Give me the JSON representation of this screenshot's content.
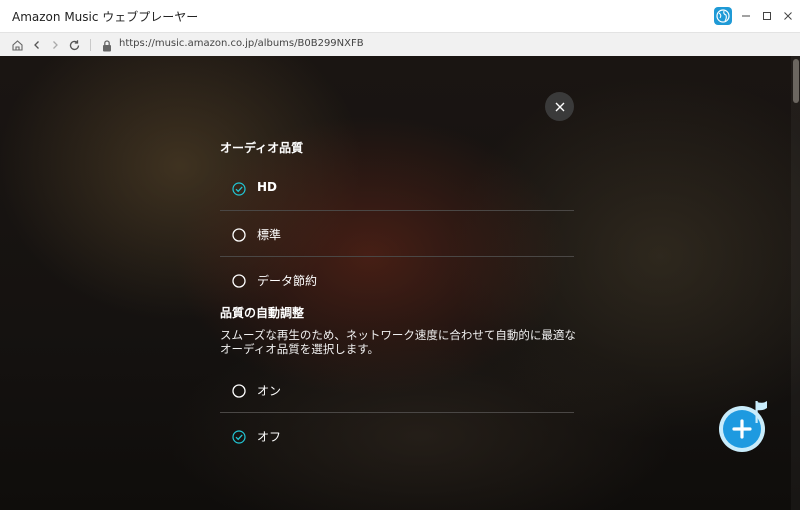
{
  "window": {
    "title": "Amazon Music ウェブプレーヤー"
  },
  "addressbar": {
    "url": "https://music.amazon.co.jp/albums/B0B299NXFB"
  },
  "settings": {
    "audio_quality_title": "オーディオ品質",
    "audio_quality_options": [
      {
        "label": "HD",
        "selected": true
      },
      {
        "label": "標準",
        "selected": false
      },
      {
        "label": "データ節約",
        "selected": false
      }
    ],
    "auto_adjust_title": "品質の自動調整",
    "auto_adjust_description": "スムーズな再生のため、ネットワーク速度に合わせて自動的に最適なオーディオ品質を選択します。",
    "auto_adjust_options": [
      {
        "label": "オン",
        "selected": false
      },
      {
        "label": "オフ",
        "selected": true
      }
    ]
  },
  "colors": {
    "accent": "#22c7d6",
    "fab": "#1e9ae0"
  },
  "icons": {
    "globe": "globe-icon",
    "close": "close-icon",
    "fab": "add-music-icon"
  }
}
